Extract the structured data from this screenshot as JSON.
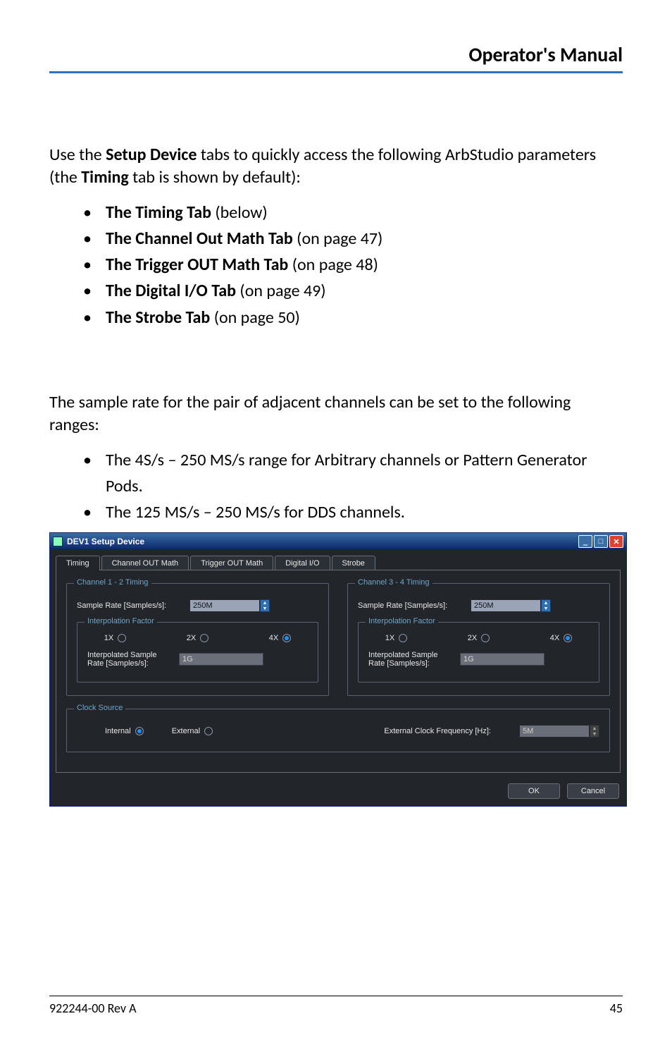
{
  "header": {
    "title": "Operator's Manual"
  },
  "intro": {
    "pre": "Use the ",
    "bold1": "Setup Device",
    "mid": " tabs to quickly access the following ArbStudio parameters (the ",
    "bold2": "Timing",
    "post": " tab is shown by default):"
  },
  "tabs_list": [
    {
      "bold": "The Timing Tab",
      "rest": " (below)"
    },
    {
      "bold": "The Channel Out Math Tab",
      "rest": " (on page 47)"
    },
    {
      "bold": "The Trigger OUT Math Tab",
      "rest": " (on page 48)"
    },
    {
      "bold": "The Digital I/O Tab",
      "rest": " (on page 49)"
    },
    {
      "bold": "The Strobe Tab",
      "rest": " (on page 50)"
    }
  ],
  "section2_intro": "The sample rate for the pair of adjacent channels can be set to the following ranges:",
  "ranges_list": [
    "The 4S/s – 250 MS/s range for Arbitrary channels or Pattern Generator Pods.",
    "The 125 MS/s – 250 MS/s for DDS channels."
  ],
  "dialog": {
    "title": "DEV1 Setup Device",
    "tabs": [
      "Timing",
      "Channel OUT Math",
      "Trigger OUT Math",
      "Digital I/O",
      "Strobe"
    ],
    "active_tab": 0,
    "ch12": {
      "legend": "Channel 1 - 2 Timing",
      "sr_label": "Sample Rate [Samples/s]:",
      "sr_value": "250M",
      "interp_legend": "Interpolation Factor",
      "interp_opts": [
        "1X",
        "2X",
        "4X"
      ],
      "interp_sel": 2,
      "isr_label": "Interpolated Sample\nRate [Samples/s]:",
      "isr_value": "1G"
    },
    "ch34": {
      "legend": "Channel 3 - 4 Timing",
      "sr_label": "Sample Rate [Samples/s]:",
      "sr_value": "250M",
      "interp_legend": "Interpolation Factor",
      "interp_opts": [
        "1X",
        "2X",
        "4X"
      ],
      "interp_sel": 2,
      "isr_label": "Interpolated Sample\nRate [Samples/s]:",
      "isr_value": "1G"
    },
    "clock": {
      "legend": "Clock Source",
      "opts": [
        "Internal",
        "External"
      ],
      "sel": 0,
      "ext_label": "External Clock Frequency [Hz]:",
      "ext_value": "5M"
    },
    "buttons": {
      "ok": "OK",
      "cancel": "Cancel"
    }
  },
  "footer": {
    "left": "922244-00 Rev A",
    "right": "45"
  }
}
